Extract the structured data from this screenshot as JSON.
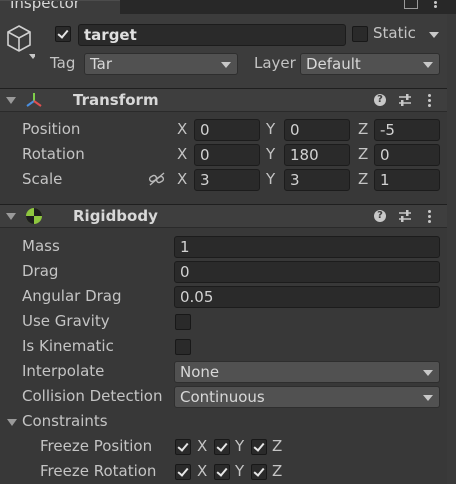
{
  "window": {
    "tab_title": "Inspector"
  },
  "object": {
    "name": "target",
    "active": true,
    "static_label": "Static",
    "static_checked": false,
    "tag_label": "Tag",
    "tag_value": "Tar",
    "layer_label": "Layer",
    "layer_value": "Default"
  },
  "transform": {
    "title": "Transform",
    "position": {
      "label": "Position",
      "x": "0",
      "y": "0",
      "z": "-5"
    },
    "rotation": {
      "label": "Rotation",
      "x": "0",
      "y": "180",
      "z": "0"
    },
    "scale": {
      "label": "Scale",
      "x": "3",
      "y": "3",
      "z": "1"
    },
    "axis_x": "X",
    "axis_y": "Y",
    "axis_z": "Z"
  },
  "rigidbody": {
    "title": "Rigidbody",
    "mass": {
      "label": "Mass",
      "value": "1"
    },
    "drag": {
      "label": "Drag",
      "value": "0"
    },
    "angular_drag": {
      "label": "Angular Drag",
      "value": "0.05"
    },
    "use_gravity": {
      "label": "Use Gravity",
      "checked": false
    },
    "is_kinematic": {
      "label": "Is Kinematic",
      "checked": false
    },
    "interpolate": {
      "label": "Interpolate",
      "value": "None"
    },
    "collision_detection": {
      "label": "Collision Detection",
      "value": "Continuous"
    },
    "constraints": {
      "label": "Constraints",
      "freeze_position": {
        "label": "Freeze Position",
        "x": true,
        "y": true,
        "z": true
      },
      "freeze_rotation": {
        "label": "Freeze Rotation",
        "x": true,
        "y": true,
        "z": true
      }
    }
  },
  "colors": {
    "background": "#383838",
    "field": "#2a2a2a",
    "header": "#3e3e3e",
    "text": "#c4c4c4"
  }
}
